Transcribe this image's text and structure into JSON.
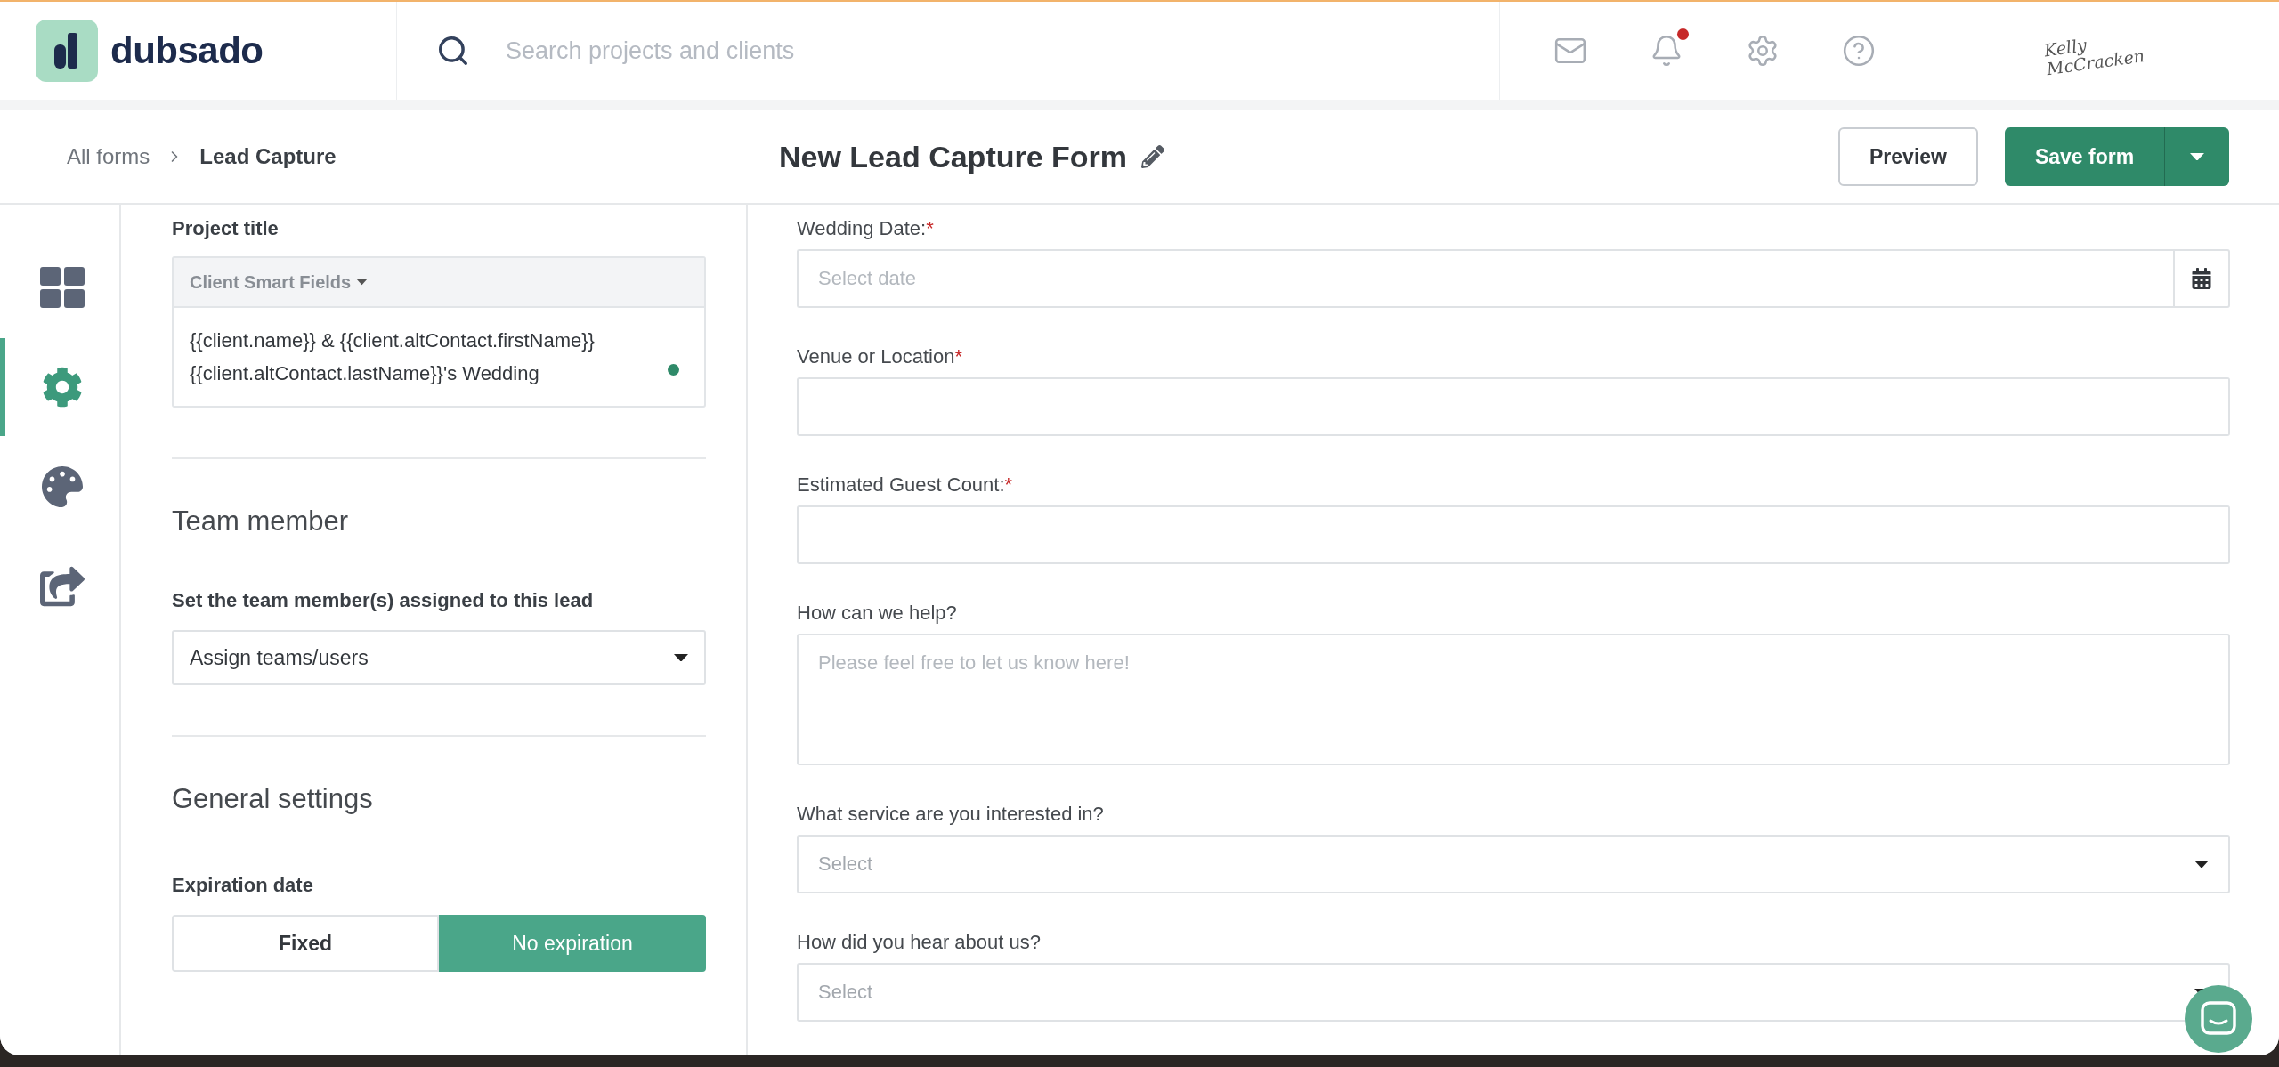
{
  "topbar": {
    "logo": "dubsado",
    "search": {
      "placeholder": "Search projects and clients"
    },
    "notifications_unread": true,
    "signature": "Kelly McCracken"
  },
  "header": {
    "breadcrumb": [
      {
        "label": "All forms",
        "selected": false
      },
      {
        "label": "Lead Capture",
        "selected": true
      }
    ],
    "title": "New Lead Capture Form",
    "buttons": {
      "preview": "Preview",
      "save": "Save form"
    }
  },
  "rail": [
    {
      "kind": "layout",
      "selected": false
    },
    {
      "kind": "settings",
      "selected": true
    },
    {
      "kind": "style",
      "selected": false
    },
    {
      "kind": "share",
      "selected": false
    }
  ],
  "settings": {
    "project_title": {
      "label": "Project title",
      "smart_fields": "Client Smart Fields",
      "value": "{{client.name}} & {{client.altContact.firstName}} {{client.altContact.lastName}}'s Wedding"
    },
    "team": {
      "heading": "Team member",
      "label": "Set the team member(s) assigned to this lead",
      "select": "Assign teams/users"
    },
    "general": {
      "heading": "General settings",
      "expiration": {
        "label": "Expiration date",
        "options": [
          {
            "label": "Fixed",
            "selected": false
          },
          {
            "label": "No expiration",
            "selected": true
          }
        ]
      }
    }
  },
  "fields": [
    {
      "kind": "date",
      "label": "Wedding Date:",
      "required_mark": "*",
      "placeholder": "Select date"
    },
    {
      "kind": "text",
      "label": "Venue or Location",
      "required_mark": "*"
    },
    {
      "kind": "text",
      "label": "Estimated Guest Count:",
      "required_mark": "*"
    },
    {
      "kind": "textarea",
      "label": "How can we help?",
      "placeholder": "Please feel free to let us know here!"
    },
    {
      "kind": "select",
      "label": "What service are you interested in?",
      "placeholder": "Select"
    },
    {
      "kind": "select",
      "label": "How did you hear about us?",
      "placeholder": "Select"
    }
  ]
}
